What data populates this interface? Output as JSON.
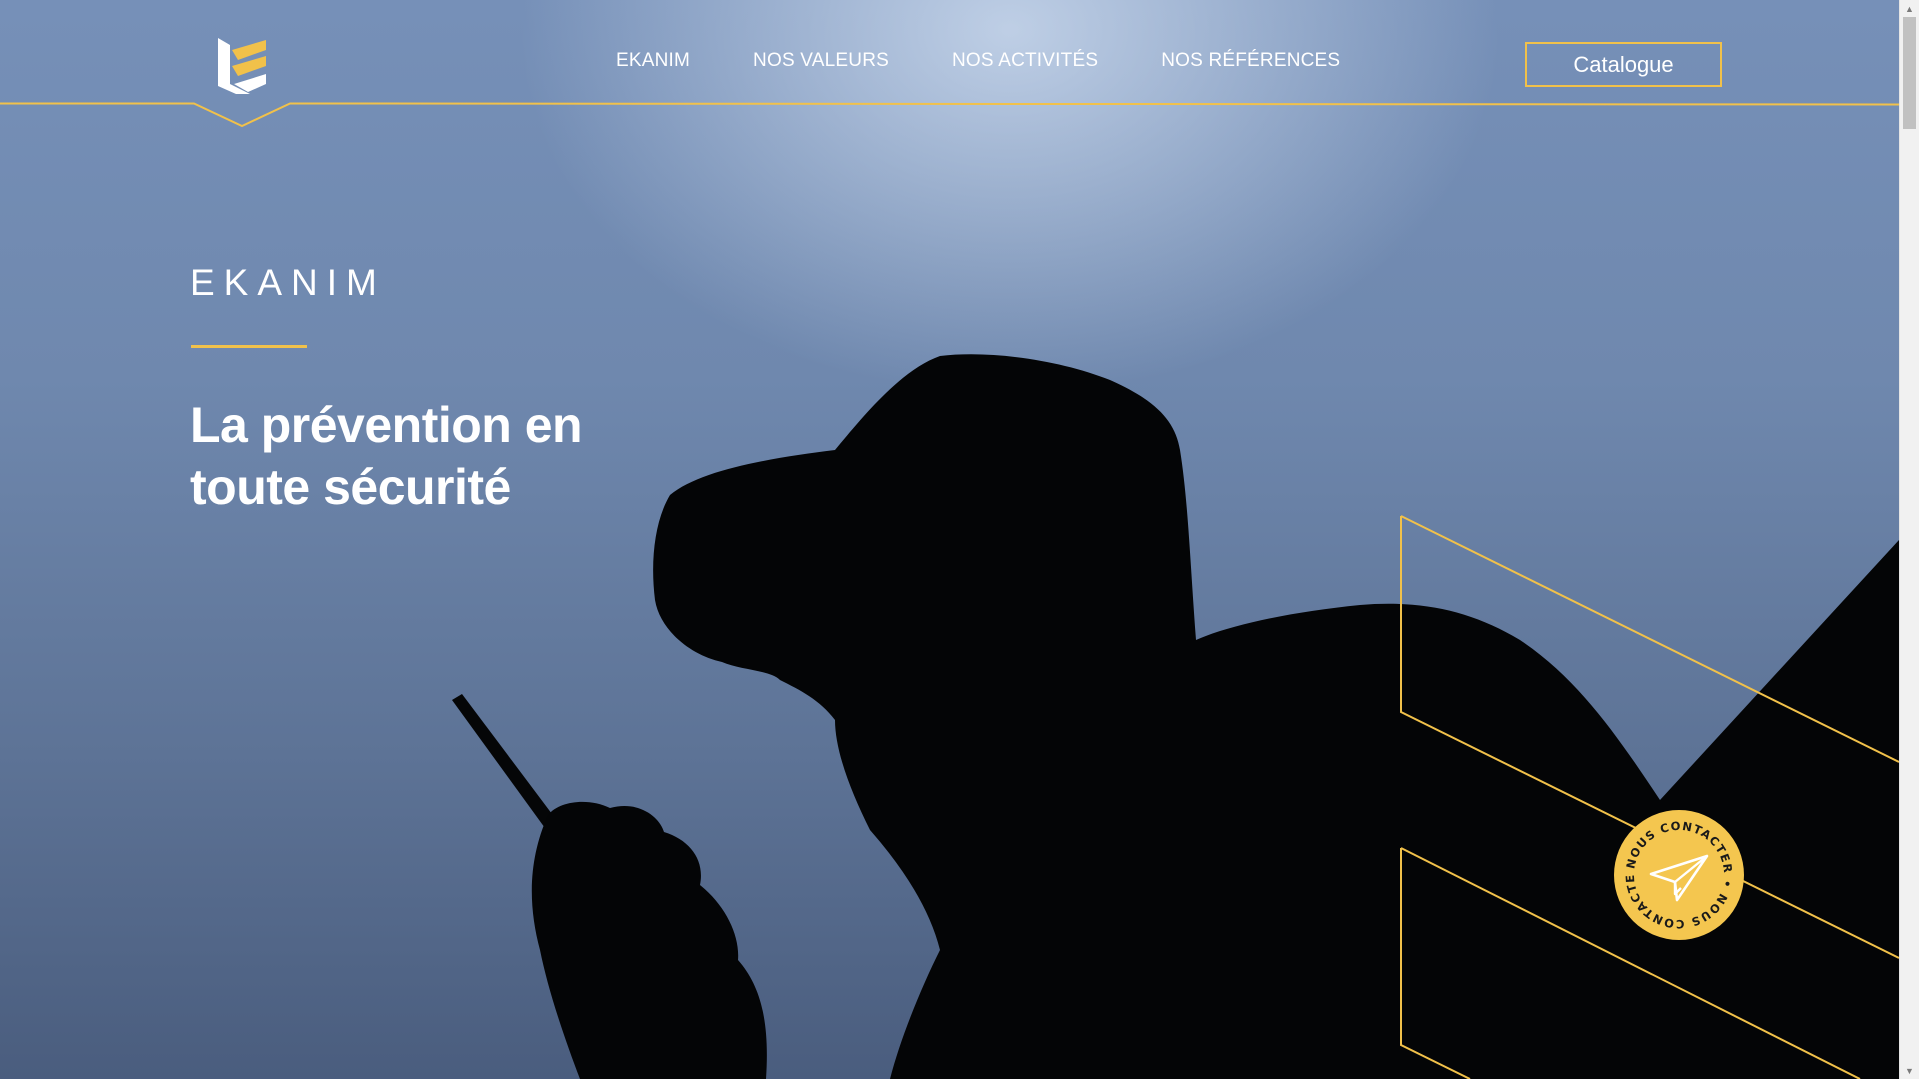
{
  "nav": {
    "items": [
      {
        "label": "EKANIM"
      },
      {
        "label": "NOS VALEURS"
      },
      {
        "label": "NOS ACTIVITÉS"
      },
      {
        "label": "NOS RÉFÉRENCES"
      }
    ],
    "catalogue_label": "Catalogue"
  },
  "logo": {
    "icon": "ekanim-e-logo-icon"
  },
  "hero": {
    "brand": "EKANIM",
    "headline_line1": "La prévention en",
    "headline_line2": "toute sécurité",
    "image": "silhouette of a man in a cap holding a walkie-talkie against a blue sky"
  },
  "contact": {
    "ring_text": "NOUS CONTACTER • NOUS CONTACTER •",
    "icon": "paper-plane-icon"
  },
  "colors": {
    "accent": "#f1c14a",
    "badge": "#f4c64f",
    "text": "#ffffff",
    "sky": "#6f88ae"
  },
  "scrollbar": {
    "up_icon": "scroll-up-arrow-icon",
    "down_icon": "scroll-down-arrow-icon"
  }
}
